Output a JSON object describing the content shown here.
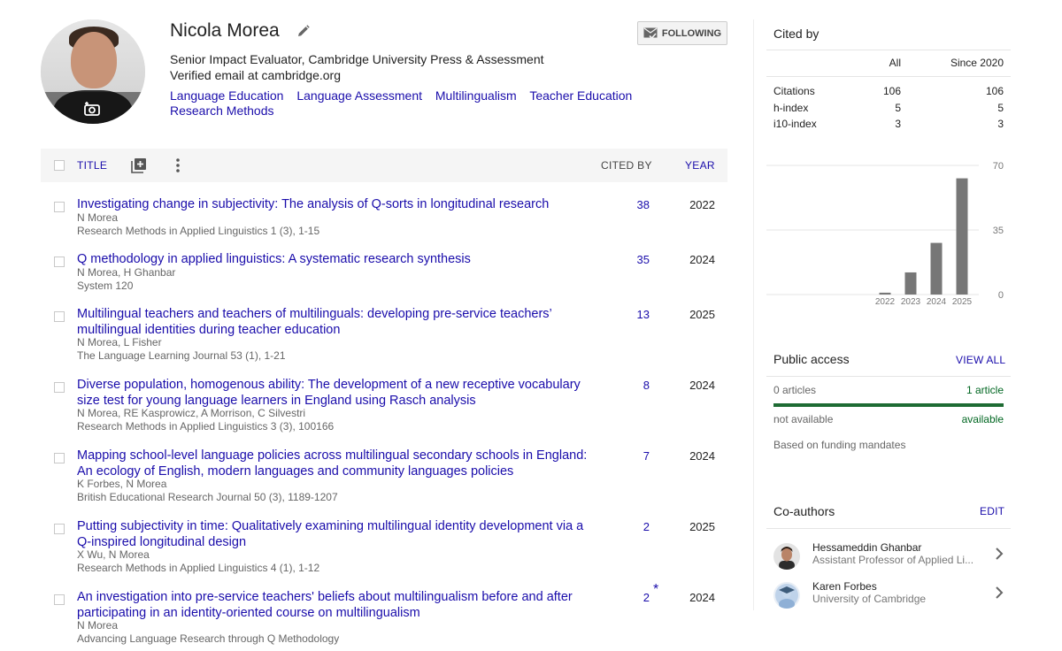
{
  "profile": {
    "name": "Nicola Morea",
    "affiliation": "Senior Impact Evaluator, Cambridge University Press & Assessment",
    "email": "Verified email at cambridge.org",
    "interests": [
      "Language Education",
      "Language Assessment",
      "Multilingualism",
      "Teacher Education",
      "Research Methods"
    ],
    "follow_label": "FOLLOWING"
  },
  "table": {
    "title_header": "TITLE",
    "cited_header": "CITED BY",
    "year_header": "YEAR",
    "articles": [
      {
        "title": "Investigating change in subjectivity: The analysis of Q-sorts in longitudinal research",
        "authors": "N Morea",
        "venue": "Research Methods in Applied Linguistics 1 (3), 1-15",
        "cited": "38",
        "year": "2022"
      },
      {
        "title": "Q methodology in applied linguistics: A systematic research synthesis",
        "authors": "N Morea, H Ghanbar",
        "venue": "System 120",
        "cited": "35",
        "year": "2024"
      },
      {
        "title": "Multilingual teachers and teachers of multilinguals: developing pre-service teachers’ multilingual identities during teacher education",
        "authors": "N Morea, L Fisher",
        "venue": "The Language Learning Journal 53 (1), 1-21",
        "cited": "13",
        "year": "2025"
      },
      {
        "title": "Diverse population, homogenous ability: The development of a new receptive vocabulary size test for young language learners in England using Rasch analysis",
        "authors": "N Morea, RE Kasprowicz, A Morrison, C Silvestri",
        "venue": "Research Methods in Applied Linguistics 3 (3), 100166",
        "cited": "8",
        "year": "2024"
      },
      {
        "title": "Mapping school-level language policies across multilingual secondary schools in England: An ecology of English, modern languages and community languages policies",
        "authors": "K Forbes, N Morea",
        "venue": "British Educational Research Journal 50 (3), 1189-1207",
        "cited": "7",
        "year": "2024"
      },
      {
        "title": "Putting subjectivity in time: Qualitatively examining multilingual identity development via a Q-inspired longitudinal design",
        "authors": "X Wu, N Morea",
        "venue": "Research Methods in Applied Linguistics 4 (1), 1-12",
        "cited": "2",
        "year": "2025"
      },
      {
        "title": "An investigation into pre-service teachers' beliefs about multilingualism before and after participating in an identity-oriented course on multilingualism",
        "authors": "N Morea",
        "venue": "Advancing Language Research through Q Methodology",
        "cited": "2",
        "star": "*",
        "year": "2024"
      }
    ]
  },
  "cited_by": {
    "title": "Cited by",
    "col_all": "All",
    "col_since": "Since 2020",
    "rows": [
      {
        "label": "Citations",
        "all": "106",
        "since": "106"
      },
      {
        "label": "h-index",
        "all": "5",
        "since": "5"
      },
      {
        "label": "i10-index",
        "all": "3",
        "since": "3"
      }
    ]
  },
  "chart_data": {
    "type": "bar",
    "categories": [
      "2022",
      "2023",
      "2024",
      "2025"
    ],
    "values": [
      1,
      12,
      28,
      63
    ],
    "ylim": [
      0,
      70
    ],
    "yticks": [
      "70",
      "35",
      "0"
    ],
    "grid": true,
    "bar_color": "#777777"
  },
  "public_access": {
    "title": "Public access",
    "view_all": "VIEW ALL",
    "left_count": "0 articles",
    "right_count": "1 article",
    "left_status": "not available",
    "right_status": "available",
    "note": "Based on funding mandates"
  },
  "coauthors": {
    "title": "Co-authors",
    "edit": "EDIT",
    "items": [
      {
        "name": "Hessameddin Ghanbar",
        "affiliation": "Assistant Professor of Applied Li..."
      },
      {
        "name": "Karen Forbes",
        "affiliation": "University of Cambridge"
      }
    ]
  }
}
